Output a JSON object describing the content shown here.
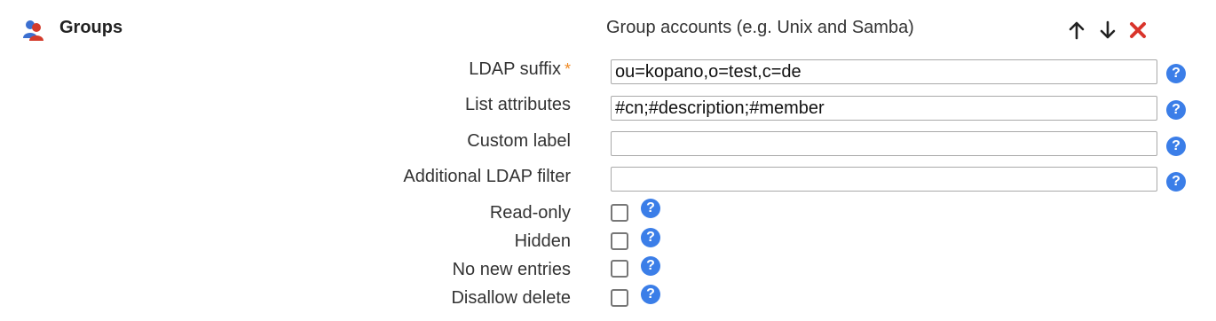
{
  "header": {
    "icon": "groups-icon",
    "title": "Groups",
    "description": "Group accounts (e.g. Unix and Samba)",
    "actions": [
      {
        "icon": "arrow-up-icon",
        "color": "#222222"
      },
      {
        "icon": "arrow-down-icon",
        "color": "#222222"
      },
      {
        "icon": "remove-icon",
        "color": "#d9342b"
      }
    ]
  },
  "text_fields": [
    {
      "label": "LDAP suffix",
      "required_mark": "*",
      "value": "ou=kopano,o=test,c=de"
    },
    {
      "label": "List attributes",
      "value": "#cn;#description;#member"
    },
    {
      "label": "Custom label",
      "value": ""
    },
    {
      "label": "Additional LDAP filter",
      "value": ""
    }
  ],
  "checkbox_fields": [
    {
      "label": "Read-only",
      "checked": false
    },
    {
      "label": "Hidden",
      "checked": false
    },
    {
      "label": "No new entries",
      "checked": false
    },
    {
      "label": "Disallow delete",
      "checked": false
    }
  ],
  "help_icon": {
    "glyph": "?",
    "color": "#3b7ee8"
  },
  "colors": {
    "required": "#f08a24",
    "help": "#3b7ee8",
    "remove": "#d9342b"
  }
}
